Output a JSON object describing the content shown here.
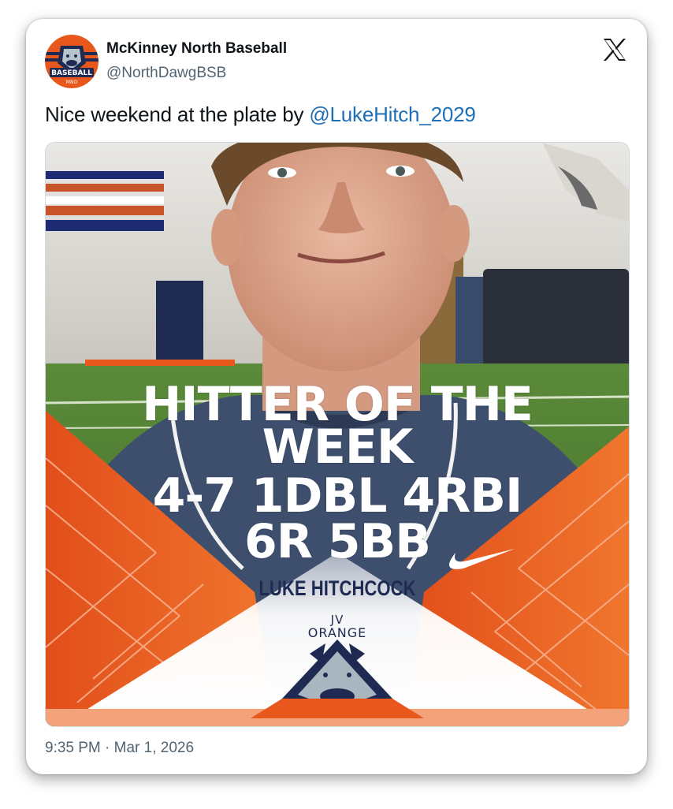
{
  "account": {
    "display_name": "McKinney North Baseball",
    "handle": "@NorthDawgBSB",
    "avatar_text": "BASEBALL",
    "avatar_subtext": "MNO"
  },
  "tweet": {
    "text_prefix": "Nice weekend at the plate by ",
    "mention": "@LukeHitch_2029",
    "timestamp": "9:35 PM · Mar 1, 2026"
  },
  "graphic": {
    "line1": "HITTER OF THE",
    "line2": "WEEK",
    "line3": "4-7  1DBL  4RBI",
    "line4": "6R 5BB",
    "player": "LUKE HITCHCOCK",
    "team_line1": "JV",
    "team_line2": "ORANGE"
  },
  "icons": {
    "close": "x-logo-icon",
    "swoosh": "nike-swoosh-icon",
    "mascot": "bulldog-logo-icon"
  },
  "colors": {
    "accent_orange": "#e8581d",
    "navy": "#1e2a52",
    "mention_blue": "#1d6fb8"
  }
}
